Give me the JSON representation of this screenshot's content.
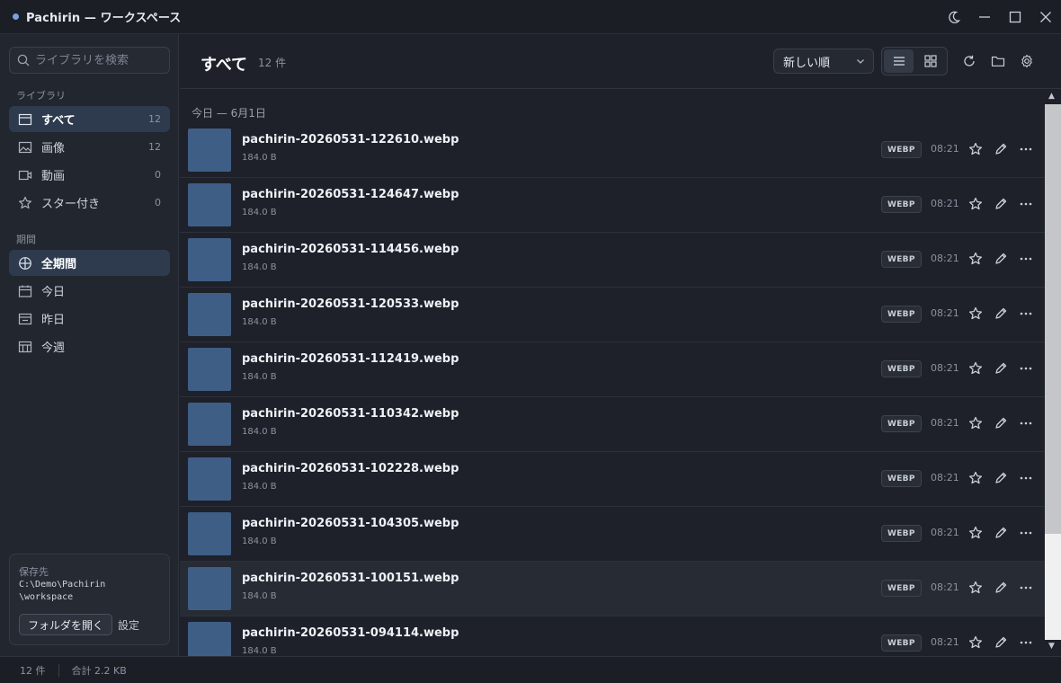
{
  "window": {
    "title": "Pachirin — ワークスペース"
  },
  "sidebar": {
    "search_placeholder": "ライブラリを検索",
    "library_label": "ライブラリ",
    "library_items": [
      {
        "label": "すべて",
        "count": "12",
        "icon": "list-icon",
        "active": true
      },
      {
        "label": "画像",
        "count": "12",
        "icon": "image-icon",
        "active": false
      },
      {
        "label": "動画",
        "count": "0",
        "icon": "video-icon",
        "active": false
      },
      {
        "label": "スター付き",
        "count": "0",
        "icon": "star-icon",
        "active": false
      }
    ],
    "period_label": "期間",
    "period_items": [
      {
        "label": "全期間",
        "icon": "globe-icon",
        "active": true
      },
      {
        "label": "今日",
        "icon": "calendar-icon",
        "active": false
      },
      {
        "label": "昨日",
        "icon": "calendar-yesterday-icon",
        "active": false
      },
      {
        "label": "今週",
        "icon": "calendar-week-icon",
        "active": false
      }
    ],
    "save": {
      "label": "保存先",
      "path": "C:\\Demo\\Pachirin\n\\workspace",
      "open_folder": "フォルダを開く",
      "settings": "設定"
    }
  },
  "header": {
    "title": "すべて",
    "count": "12 件",
    "sort_value": "新しい順"
  },
  "list": {
    "group_label": "今日 — 6月1日",
    "rows": [
      {
        "name": "pachirin-20260531-122610.webp",
        "size": "184.0 B",
        "type": "WEBP",
        "time": "08:21"
      },
      {
        "name": "pachirin-20260531-124647.webp",
        "size": "184.0 B",
        "type": "WEBP",
        "time": "08:21"
      },
      {
        "name": "pachirin-20260531-114456.webp",
        "size": "184.0 B",
        "type": "WEBP",
        "time": "08:21"
      },
      {
        "name": "pachirin-20260531-120533.webp",
        "size": "184.0 B",
        "type": "WEBP",
        "time": "08:21"
      },
      {
        "name": "pachirin-20260531-112419.webp",
        "size": "184.0 B",
        "type": "WEBP",
        "time": "08:21"
      },
      {
        "name": "pachirin-20260531-110342.webp",
        "size": "184.0 B",
        "type": "WEBP",
        "time": "08:21"
      },
      {
        "name": "pachirin-20260531-102228.webp",
        "size": "184.0 B",
        "type": "WEBP",
        "time": "08:21"
      },
      {
        "name": "pachirin-20260531-104305.webp",
        "size": "184.0 B",
        "type": "WEBP",
        "time": "08:21"
      },
      {
        "name": "pachirin-20260531-100151.webp",
        "size": "184.0 B",
        "type": "WEBP",
        "time": "08:21"
      },
      {
        "name": "pachirin-20260531-094114.webp",
        "size": "184.0 B",
        "type": "WEBP",
        "time": "08:21"
      }
    ]
  },
  "status": {
    "count": "12 件",
    "total": "合計 2.2 KB"
  },
  "colors": {
    "accent": "#7aa2e0",
    "active_bg": "#2e3b4e",
    "thumb": "#3f5e86",
    "background": "#1e2129"
  }
}
